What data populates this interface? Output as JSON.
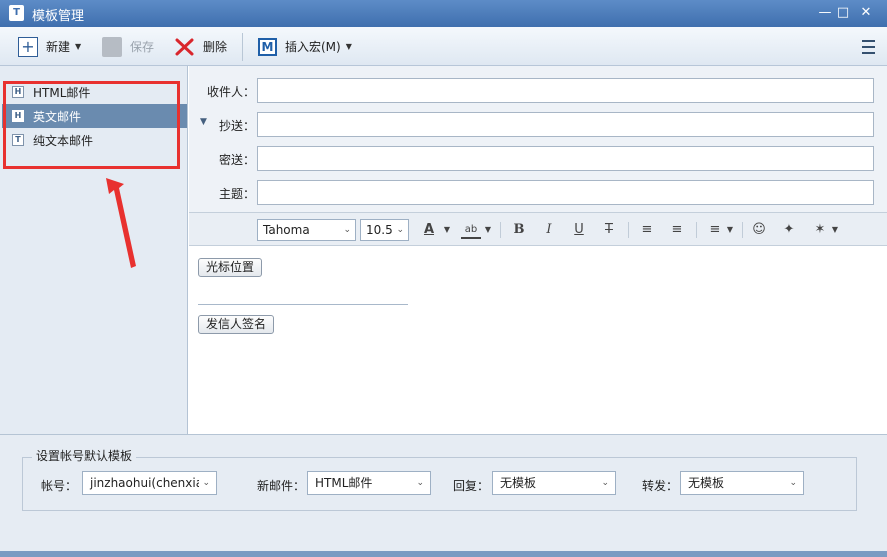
{
  "window": {
    "title": "模板管理",
    "app_icon": "T"
  },
  "toolbar": {
    "new_label": "新建",
    "save_label": "保存",
    "delete_label": "删除",
    "insert_macro_label": "插入宏(M)"
  },
  "templates": {
    "items": [
      {
        "label": "HTML邮件",
        "badge": "H",
        "selected": false
      },
      {
        "label": "英文邮件",
        "badge": "H",
        "selected": true
      },
      {
        "label": "纯文本邮件",
        "badge": "T",
        "selected": false
      }
    ]
  },
  "header_fields": {
    "to_label": "收件人：",
    "cc_label": "抄送：",
    "bcc_label": "密送：",
    "subject_label": "主题："
  },
  "format_bar": {
    "font_family": "Tahoma",
    "font_size": "10.5",
    "text_color_glyph": "A",
    "highlight_glyph": "ab",
    "bold_glyph": "B",
    "italic_glyph": "I",
    "underline_glyph": "U",
    "strike_glyph": "T"
  },
  "editor": {
    "cursor_button": "光标位置",
    "signature_button": "发信人签名"
  },
  "defaults": {
    "group_title": "设置帐号默认模板",
    "account_label": "帐号：",
    "account_value": "jinzhaohui(chenxiao",
    "new_mail_label": "新邮件：",
    "new_mail_value": "HTML邮件",
    "reply_label": "回复：",
    "reply_value": "无模板",
    "forward_label": "转发：",
    "forward_value": "无模板"
  },
  "annotation": {
    "highlight_color": "#e8312f"
  }
}
